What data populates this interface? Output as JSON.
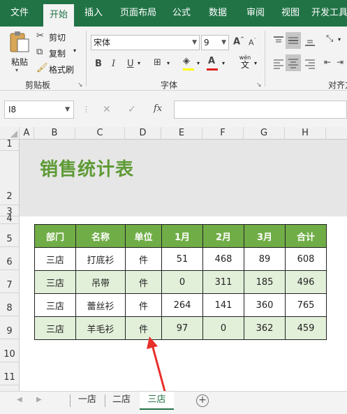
{
  "menu": {
    "tabs": [
      "文件",
      "开始",
      "插入",
      "页面布局",
      "公式",
      "数据",
      "审阅",
      "视图",
      "开发工具"
    ],
    "active": "开始"
  },
  "ribbon": {
    "clipboard": {
      "paste": "粘贴",
      "cut": "剪切",
      "copy": "复制",
      "format_painter": "格式刷",
      "label": "剪贴板"
    },
    "font": {
      "font_name": "宋体",
      "font_size": "9",
      "bold": "B",
      "italic": "I",
      "underline": "U",
      "grow": "A",
      "shrink": "A",
      "wen": "wén",
      "wen_char": "文",
      "label": "字体"
    },
    "align": {
      "label": "对齐方"
    }
  },
  "formula_bar": {
    "name_box": "I8",
    "cancel": "✕",
    "enter": "✓",
    "fx": "fx",
    "value": ""
  },
  "columns": [
    "A",
    "B",
    "C",
    "D",
    "E",
    "F",
    "G",
    "H"
  ],
  "rows": [
    "1",
    "2",
    "3",
    "4",
    "5",
    "6",
    "7",
    "8",
    "9",
    "10",
    "11"
  ],
  "sheet_title": "销售统计表",
  "table": {
    "headers": [
      "部门",
      "名称",
      "单位",
      "1月",
      "2月",
      "3月",
      "合计"
    ],
    "rows": [
      [
        "三店",
        "打底衫",
        "件",
        "51",
        "468",
        "89",
        "608"
      ],
      [
        "三店",
        "吊带",
        "件",
        "0",
        "311",
        "185",
        "496"
      ],
      [
        "三店",
        "蕾丝衫",
        "件",
        "264",
        "141",
        "360",
        "765"
      ],
      [
        "三店",
        "羊毛衫",
        "件",
        "97",
        "0",
        "362",
        "459"
      ]
    ]
  },
  "sheets": {
    "tabs": [
      "一店",
      "二店",
      "三店"
    ],
    "active": "三店",
    "add": "+"
  },
  "colors": {
    "accent": "#217346",
    "header_green": "#70ad47",
    "band": "#e2efd9",
    "title": "#5e9a35",
    "arrow": "#e8302a"
  }
}
